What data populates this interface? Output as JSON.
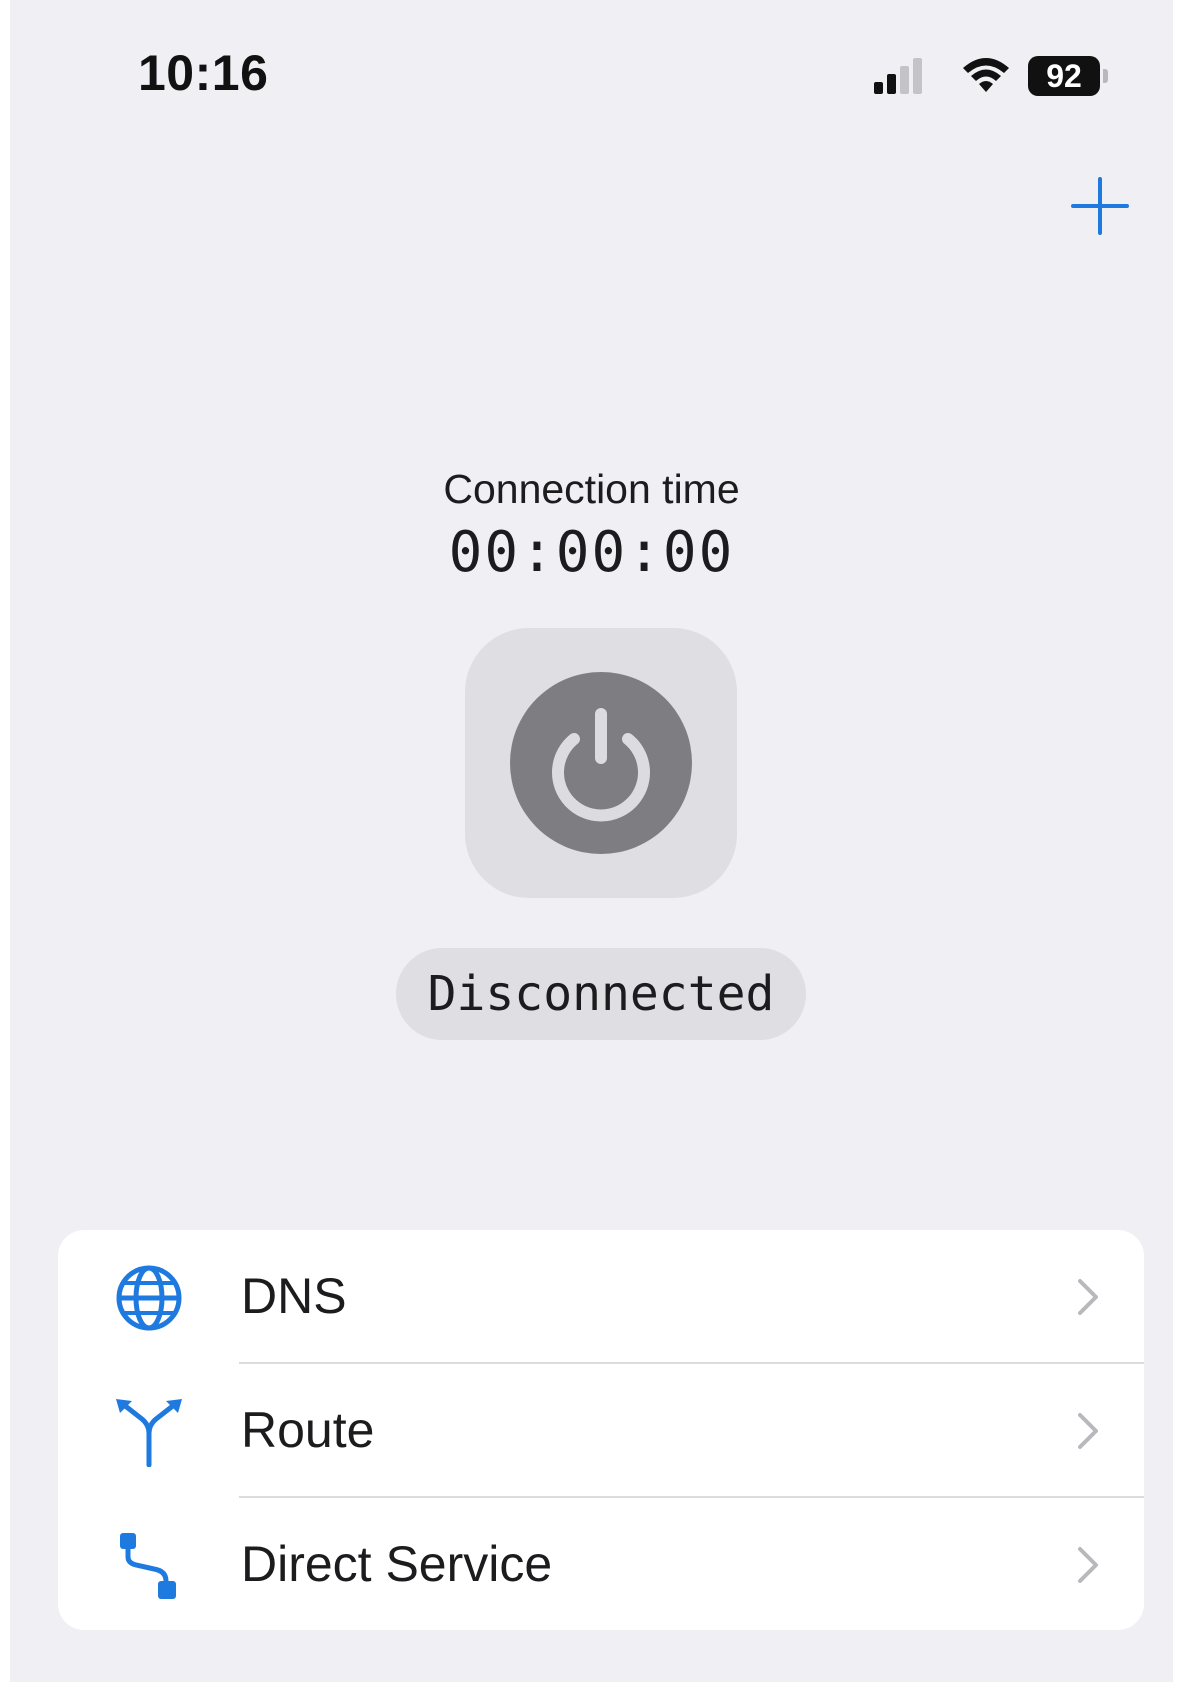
{
  "status_bar": {
    "time": "10:16",
    "battery": "92"
  },
  "connection": {
    "label": "Connection time",
    "timer": "00:00:00",
    "status": "Disconnected"
  },
  "settings": {
    "items": [
      {
        "label": "DNS",
        "icon": "globe-icon"
      },
      {
        "label": "Route",
        "icon": "route-split-icon"
      },
      {
        "label": "Direct Service",
        "icon": "direct-path-icon"
      }
    ]
  },
  "colors": {
    "accent": "#1f7ae0",
    "background": "#efeff4",
    "power_tile": "#dedee3",
    "power_circle": "#7d7d82"
  }
}
